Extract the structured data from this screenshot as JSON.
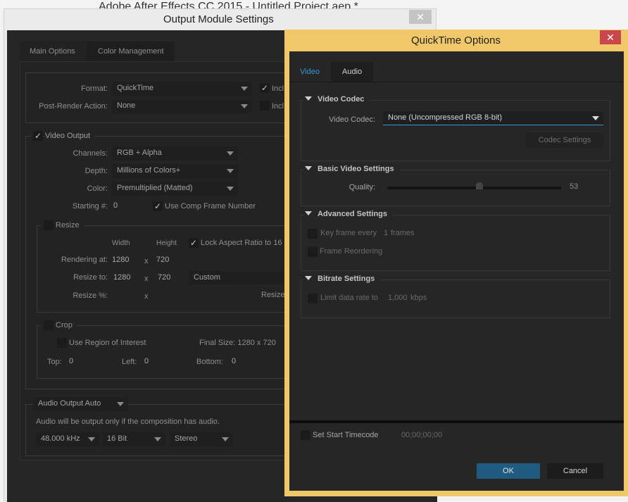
{
  "app_title": "Adobe After Effects CC 2015 - Untitled Project.aep *",
  "oms": {
    "title": "Output Module Settings",
    "tabs": [
      {
        "label": "Main Options"
      },
      {
        "label": "Color Management"
      }
    ],
    "format_label": "Format:",
    "format_value": "QuickTime",
    "post_label": "Post-Render Action:",
    "post_value": "None",
    "include1": "Incl",
    "include1_checked": true,
    "include2": "Incl",
    "include2_checked": false,
    "video_output": "Video Output",
    "video_output_checked": true,
    "channels_label": "Channels:",
    "channels_value": "RGB + Alpha",
    "depth_label": "Depth:",
    "depth_value": "Millions of Colors+",
    "color_label": "Color:",
    "color_value": "Premultiplied (Matted)",
    "starting_label": "Starting #:",
    "starting_value": "0",
    "use_comp_frame": "Use Comp Frame Number",
    "use_comp_frame_checked": true,
    "resize": "Resize",
    "width_label": "Width",
    "height_label": "Height",
    "lock_aspect": "Lock Aspect Ratio to 16",
    "rendering_label": "Rendering at:",
    "rendering_w": "1280",
    "rendering_h": "720",
    "resize_to_label": "Resize to:",
    "resize_w": "1280",
    "resize_h": "720",
    "resize_preset": "Custom",
    "resize_pct_label": "Resize %:",
    "x": "x",
    "resize_quality": "Resize",
    "crop": "Crop",
    "use_roi": "Use Region of Interest",
    "final_size": "Final Size: 1280 x 720",
    "top_label": "Top:",
    "top": "0",
    "left_label": "Left:",
    "left": "0",
    "bottom_label": "Bottom:",
    "bottom": "0",
    "audio_output": "Audio Output Auto",
    "audio_note": "Audio will be output only if the composition has audio.",
    "rate": "48.000 kHz",
    "bits": "16 Bit",
    "channels": "Stereo"
  },
  "qt": {
    "title": "QuickTime Options",
    "tabs": [
      {
        "label": "Video",
        "active": true
      },
      {
        "label": "Audio"
      }
    ],
    "video_codec_section": "Video Codec",
    "video_codec_label": "Video Codec:",
    "video_codec_value": "None (Uncompressed RGB 8-bit)",
    "codec_settings": "Codec Settings",
    "basic_section": "Basic Video Settings",
    "quality_label": "Quality:",
    "quality": 53,
    "quality_text": "53",
    "advanced_section": "Advanced Settings",
    "key_frame": "Key frame every",
    "key_frame_value": "1",
    "frames": "frames",
    "frame_reordering": "Frame Reordering",
    "bitrate_section": "Bitrate Settings",
    "limit_rate": "Limit data rate to",
    "rate_value": "1,000",
    "kbps": "kbps",
    "start_timecode": "Set Start Timecode",
    "timecode": "00;00;00;00",
    "ok": "OK",
    "cancel": "Cancel"
  },
  "colors": {
    "accent": "#1f5a80",
    "qt_border": "#f0c869",
    "close_red": "#c9474a",
    "tab_active": "#3a9ad9"
  }
}
